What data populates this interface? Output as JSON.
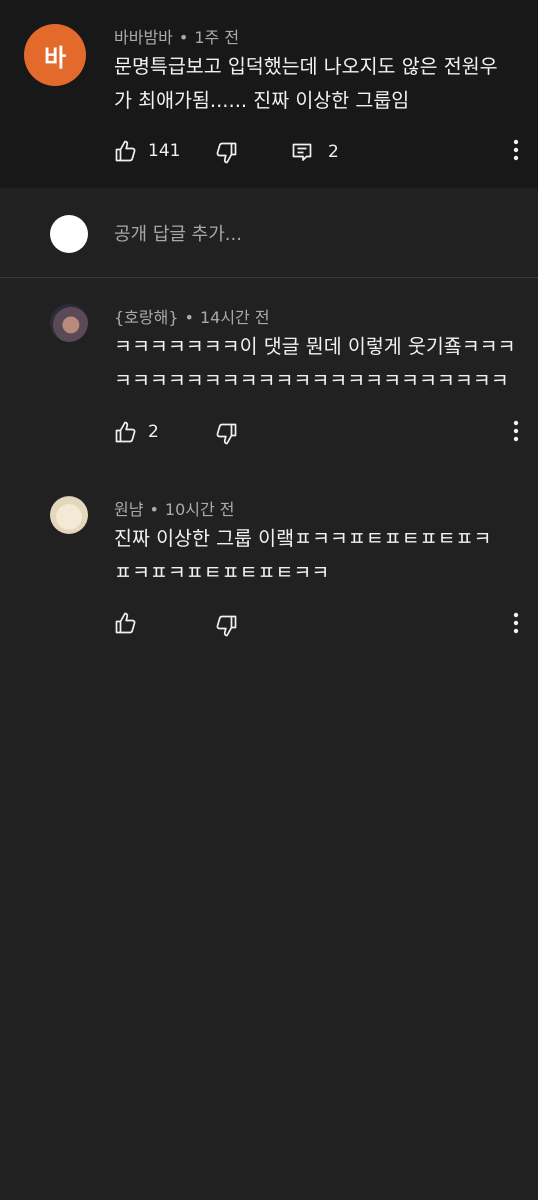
{
  "comments": [
    {
      "avatar_letter": "바",
      "author": "바바밤바",
      "time": "1주 전",
      "text": "문명특급보고 입덕했는데 나오지도 않은 전원우\n가 최애가됨...... 진짜 이상한 그룹임",
      "likes": "141",
      "replies": "2"
    },
    {
      "author": "{호랑해}",
      "time": "14시간 전",
      "text": "ㅋㅋㅋㅋㅋㅋㅋ이 댓글 뭔데 이렇게 웃기죸ㅋㅋㅋ\nㅋㅋㅋㅋㅋㅋㅋㅋㅋㅋㅋㅋㅋㅋㅋㅋㅋㅋㅋㅋㅋㅋ",
      "likes": "2"
    },
    {
      "author": "원냠",
      "time": "10시간 전",
      "text": "진짜 이상한 그룹 이랰ㅍㅋㅋㅍㅌㅍㅌㅍㅌㅍㅋ\nㅍㅋㅍㅋㅍㅌㅍㅌㅍㅌㅋㅋ",
      "likes": ""
    }
  ],
  "reply_bar": {
    "placeholder": "공개 답글 추가..."
  },
  "separator": "•",
  "icons": {
    "like": "thumbs-up-icon",
    "dislike": "thumbs-down-icon",
    "reply": "comment-icon",
    "more": "more-vertical-icon"
  },
  "colors": {
    "background": "#212121",
    "top_comment_bg": "#181818",
    "avatar_orange": "#e36a2a",
    "meta_text": "#aaaaaa"
  }
}
